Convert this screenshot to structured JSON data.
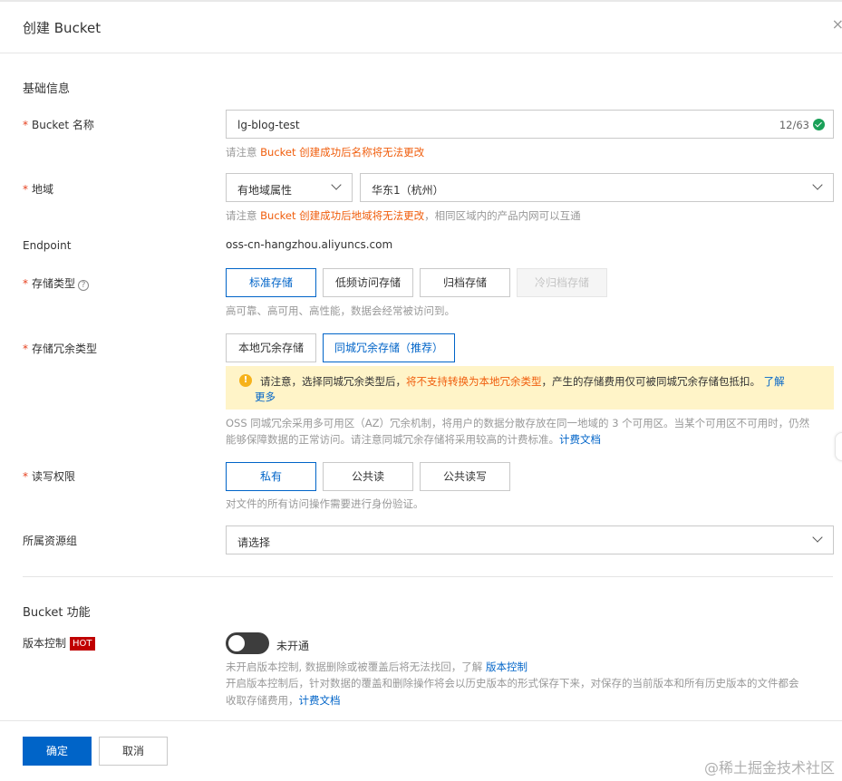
{
  "dialog": {
    "title": "创建 Bucket",
    "close_glyph": "×"
  },
  "basic": {
    "section_title": "基础信息"
  },
  "bucket_name": {
    "label": "Bucket 名称",
    "value": "lg-blog-test",
    "counter": "12/63",
    "hint_prefix": "请注意 ",
    "hint_orange": "Bucket 创建成功后名称将无法更改"
  },
  "region": {
    "label": "地域",
    "attr_select": "有地域属性",
    "region_select": "华东1（杭州）",
    "hint_prefix": "请注意 ",
    "hint_orange": "Bucket 创建成功后地域将无法更改",
    "hint_suffix": "，相同区域内的产品内网可以互通"
  },
  "endpoint": {
    "label": "Endpoint",
    "value": "oss-cn-hangzhou.aliyuncs.com"
  },
  "storage_type": {
    "label": "存储类型",
    "options": [
      "标准存储",
      "低频访问存储",
      "归档存储",
      "冷归档存储"
    ],
    "hint": "高可靠、高可用、高性能，数据会经常被访问到。"
  },
  "redundancy": {
    "label": "存储冗余类型",
    "options": [
      "本地冗余存储",
      "同城冗余存储（推荐）"
    ],
    "warn_prefix": "请注意，选择同城冗余类型后，",
    "warn_orange": "将不支持转换为本地冗余类型",
    "warn_suffix": "，产生的存储费用仅可被同城冗余存储包抵扣。",
    "warn_link_1": "了解",
    "warn_link_2": "更多",
    "desc_line1": "OSS 同城冗余采用多可用区（AZ）冗余机制，将用户的数据分散存放在同一地域的 3 个可用区。当某个可用区不可用时，仍然",
    "desc_line2": "能够保障数据的正常访问。请注意同城冗余存储将采用较高的计费标准。",
    "desc_link": "计费文档"
  },
  "acl": {
    "label": "读写权限",
    "options": [
      "私有",
      "公共读",
      "公共读写"
    ],
    "hint": "对文件的所有访问操作需要进行身份验证。"
  },
  "resource_group": {
    "label": "所属资源组",
    "placeholder": "请选择"
  },
  "features": {
    "section_title": "Bucket 功能"
  },
  "versioning": {
    "label": "版本控制",
    "badge": "HOT",
    "state": "未开通",
    "hint1": "未开启版本控制, 数据删除或被覆盖后将无法找回，了解 ",
    "hint1_link": "版本控制",
    "hint2": "开启版本控制后，针对数据的覆盖和删除操作将会以历史版本的形式保存下来，对保存的当前版本和所有历史版本的文件都会",
    "hint3": "收取存储费用，",
    "hint3_link": "计费文档"
  },
  "footer": {
    "ok": "确定",
    "cancel": "取消"
  },
  "watermark": "@稀土掘金技术社区",
  "colors": {
    "primary": "#0064c8",
    "warning_text": "#f05d0c",
    "warning_bg": "#fff4c8",
    "hot": "#c00000"
  }
}
